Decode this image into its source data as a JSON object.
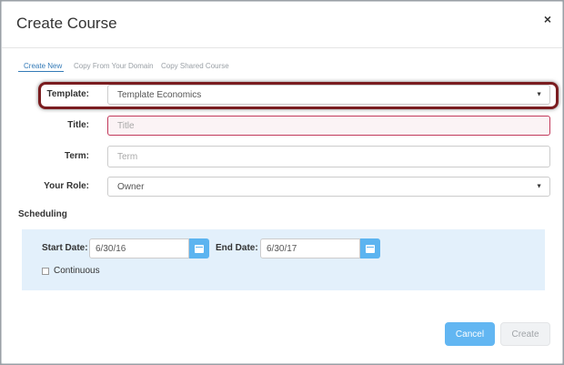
{
  "dialog": {
    "title": "Create Course",
    "close_glyph": "×"
  },
  "tabs": [
    {
      "label": "Create New",
      "active": true
    },
    {
      "label": "Copy From Your Domain",
      "active": false
    },
    {
      "label": "Copy Shared Course",
      "active": false
    }
  ],
  "form": {
    "template": {
      "label": "Template:",
      "value": "Template Economics"
    },
    "title": {
      "label": "Title:",
      "placeholder": "Title",
      "value": ""
    },
    "term": {
      "label": "Term:",
      "placeholder": "Term",
      "value": ""
    },
    "role": {
      "label": "Your Role:",
      "value": "Owner"
    }
  },
  "scheduling": {
    "title": "Scheduling",
    "start": {
      "label": "Start Date:",
      "value": "6/30/16"
    },
    "end": {
      "label": "End Date:",
      "value": "6/30/17"
    },
    "continuous": {
      "label": "Continuous",
      "checked": false
    }
  },
  "buttons": {
    "cancel": "Cancel",
    "create": "Create"
  },
  "colors": {
    "accent": "#62b6f2",
    "highlight": "#7a1d20",
    "invalid": "#c2395b",
    "schedule_bg": "#e3f0fb"
  },
  "icons": {
    "close": "close-icon",
    "dropdown": "caret-down-icon",
    "calendar": "calendar-icon"
  }
}
